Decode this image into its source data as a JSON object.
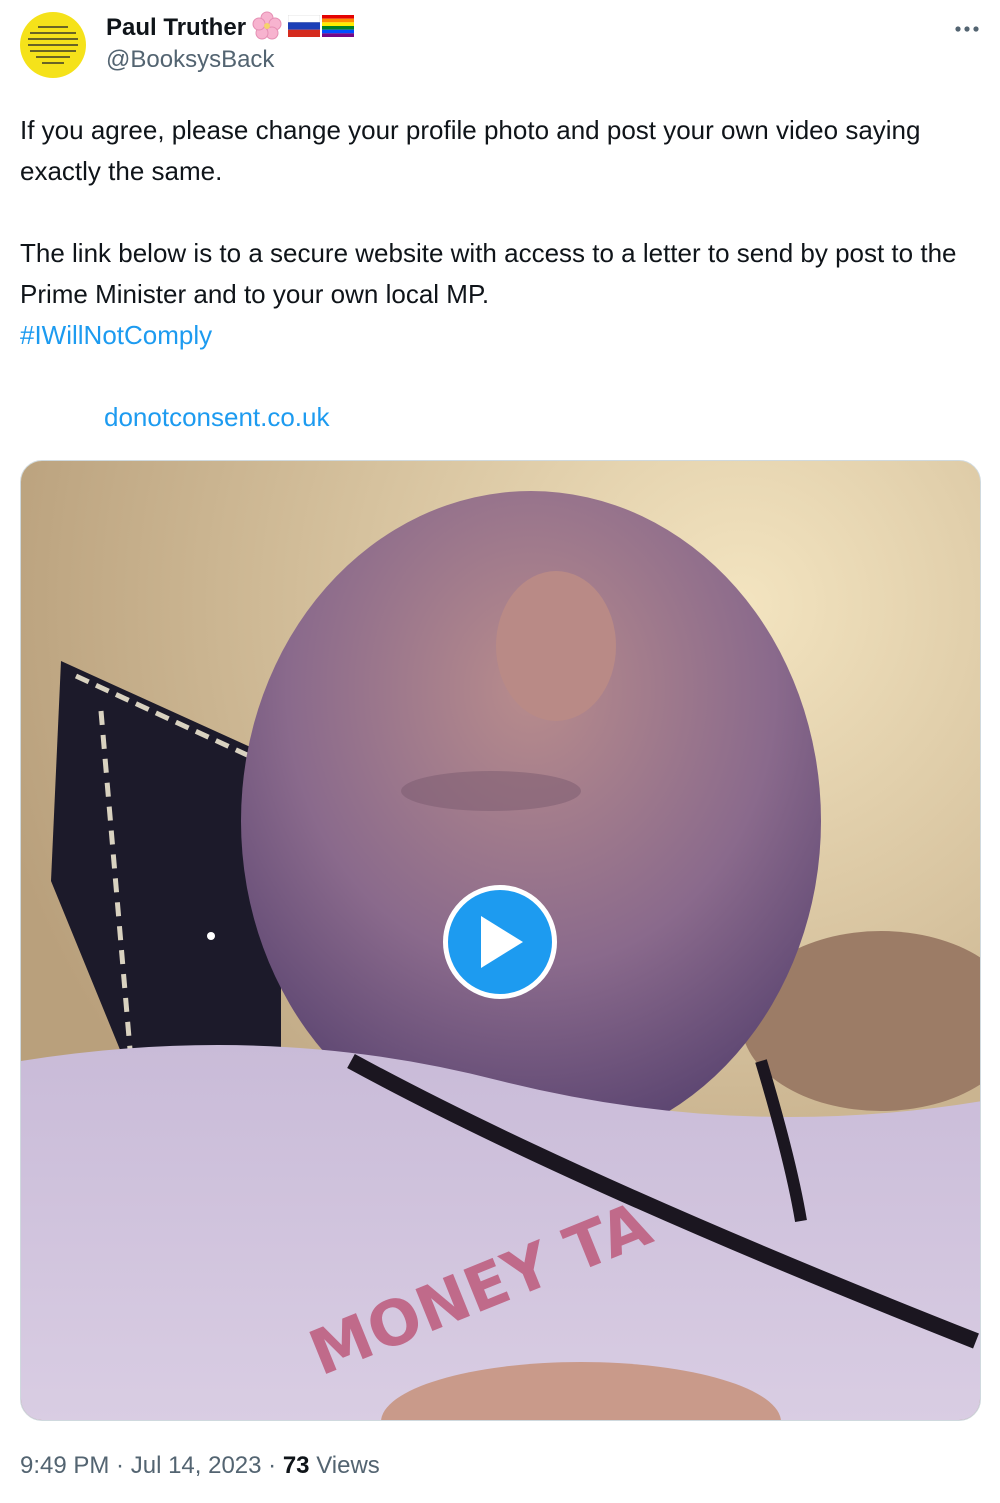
{
  "author": {
    "display_name": "Paul Truther",
    "handle": "@BooksysBack",
    "avatar_text": "I WITHDRAW MY CONSENT TO BE GOVERNED BY ANY CORRUPT, COMPROMISED, BELLIGERENT, CRIMINAL PARLIAMENT OR GOVERNMENT. I WILL NOT COMPLY",
    "badges": [
      "cherry-blossom-icon",
      "russia-flag-icon",
      "rainbow-flag-icon"
    ]
  },
  "more_menu_icon": "more-horizontal-icon",
  "tweet": {
    "paragraph_1": "If you agree, please change your profile photo and post your own video saying exactly the same.",
    "paragraph_2": "The link below is to a secure website with access to a letter to send by post to the Prime Minister and to your own local MP.",
    "hashtag": "#IWillNotComply",
    "link": "donotconsent.co.uk"
  },
  "media": {
    "type": "video",
    "play_icon": "play-icon",
    "shirt_text": "MONEY TA"
  },
  "meta": {
    "time": "9:49 PM",
    "separator_1": " · ",
    "date": "Jul 14, 2023",
    "separator_2": " · ",
    "views_count": "73",
    "views_label": " Views"
  },
  "colors": {
    "accent": "#1d9bf0",
    "text": "#0f1419",
    "secondary": "#536471",
    "avatar_bg": "#f5e21a"
  }
}
